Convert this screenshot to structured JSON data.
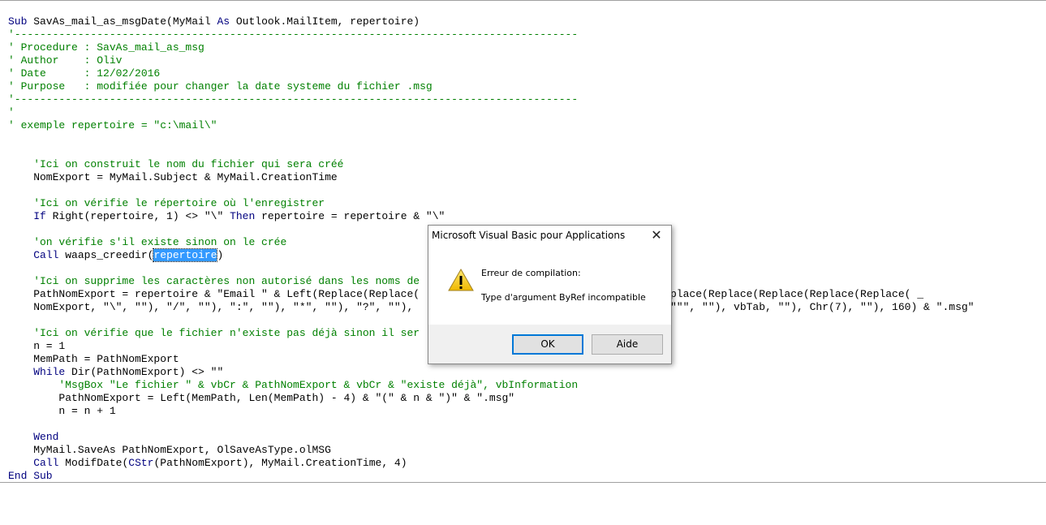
{
  "code_lines": [
    [
      [
        "Sub",
        "k"
      ],
      [
        " SavAs_mail_as_msgDate(MyMail ",
        "t"
      ],
      [
        "As",
        "k"
      ],
      [
        " Outlook.MailItem, repertoire)",
        "t"
      ]
    ],
    [
      [
        "'-----------------------------------------------------------------------------------------",
        "c"
      ]
    ],
    [
      [
        "' Procedure : SavAs_mail_as_msg",
        "c"
      ]
    ],
    [
      [
        "' Author    : Oliv",
        "c"
      ]
    ],
    [
      [
        "' Date      : 12/02/2016",
        "c"
      ]
    ],
    [
      [
        "' Purpose   : modifiée pour changer la date systeme du fichier .msg",
        "c"
      ]
    ],
    [
      [
        "'-----------------------------------------------------------------------------------------",
        "c"
      ]
    ],
    [
      [
        "'",
        "c"
      ]
    ],
    [
      [
        "' exemple repertoire = \"c:\\mail\\\"",
        "c"
      ]
    ],
    [],
    [],
    [
      [
        "    'Ici on construit le nom du fichier qui sera créé",
        "c"
      ]
    ],
    [
      [
        "    NomExport = MyMail.Subject & MyMail.CreationTime",
        "t"
      ]
    ],
    [],
    [
      [
        "    'Ici on vérifie le répertoire où l'enregistrer",
        "c"
      ]
    ],
    [
      [
        "    ",
        "t"
      ],
      [
        "If",
        "k"
      ],
      [
        " Right(repertoire, 1) <> \"\\\" ",
        "t"
      ],
      [
        "Then",
        "k"
      ],
      [
        " repertoire = repertoire & \"\\\"",
        "t"
      ]
    ],
    [],
    [
      [
        "    'on vérifie s'il existe sinon on le crée",
        "c"
      ]
    ],
    [
      [
        "    ",
        "t"
      ],
      [
        "Call",
        "k"
      ],
      [
        " waaps_creedir(",
        "t"
      ],
      [
        "repertoire",
        "s"
      ],
      [
        ")",
        "t"
      ]
    ],
    [],
    [
      [
        "    'Ici on supprime les caractères non autorisé dans les noms de",
        "c"
      ]
    ],
    [
      [
        "    PathNomExport = repertoire & \"Email \" & Left(Replace(Replace(",
        "t"
      ]
    ],
    [
      [
        "    NomExport, \"\\\", \"\"), \"/\", \"\"), \":\", \"\"), \"*\", \"\"), \"?\", \"\"),",
        "t"
      ]
    ],
    [],
    [
      [
        "    'Ici on vérifie que le fichier n'existe pas déjà sinon il ser",
        "c"
      ]
    ],
    [
      [
        "    n = 1",
        "t"
      ]
    ],
    [
      [
        "    MemPath = PathNomExport",
        "t"
      ]
    ],
    [
      [
        "    ",
        "t"
      ],
      [
        "While",
        "k"
      ],
      [
        " Dir(PathNomExport) <> \"\"",
        "t"
      ]
    ],
    [
      [
        "        'MsgBox \"Le fichier \" & vbCr & PathNomExport & vbCr & \"existe déjà\", vbInformation",
        "c"
      ]
    ],
    [
      [
        "        PathNomExport = Left(MemPath, Len(MemPath) - 4) & \"(\" & n & \")\" & \".msg\"",
        "t"
      ]
    ],
    [
      [
        "        n = n + 1",
        "t"
      ]
    ],
    [],
    [
      [
        "    ",
        "t"
      ],
      [
        "Wend",
        "k"
      ]
    ],
    [
      [
        "    MyMail.SaveAs PathNomExport, OlSaveAsType.olMSG",
        "t"
      ]
    ],
    [
      [
        "    ",
        "t"
      ],
      [
        "Call",
        "k"
      ],
      [
        " ModifDate(",
        "t"
      ],
      [
        "CStr",
        "k"
      ],
      [
        "(PathNomExport), MyMail.CreationTime, 4)",
        "t"
      ]
    ],
    [
      [
        "End Sub",
        "k"
      ]
    ]
  ],
  "code_right_parts": {
    "21": "ce(Replace(Replace(Replace(Replace(Replace( _",
    "22": "), \"\"\"\"\", \"\"), vbTab, \"\"), Chr(7), \"\"), 160) & \".msg\""
  },
  "dialog": {
    "title": "Microsoft Visual Basic pour Applications",
    "close": "✕",
    "icon": "warning-icon",
    "message1": "Erreur de compilation:",
    "message2": "Type d'argument ByRef incompatible",
    "ok_label": "OK",
    "help_label": "Aide"
  }
}
